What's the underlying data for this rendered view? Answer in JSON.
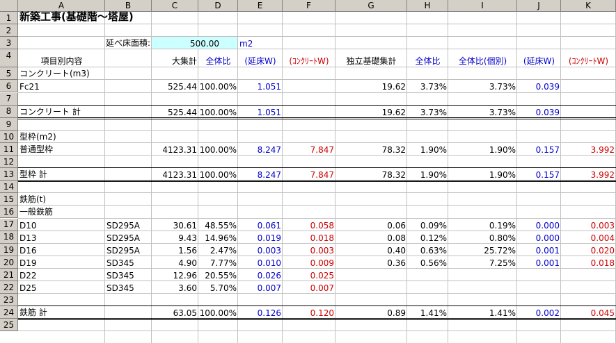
{
  "columns": [
    "A",
    "B",
    "C",
    "D",
    "E",
    "F",
    "G",
    "H",
    "I",
    "J",
    "K"
  ],
  "rows": [
    "1",
    "2",
    "3",
    "4",
    "5",
    "6",
    "7",
    "8",
    "9",
    "10",
    "11",
    "12",
    "13",
    "14",
    "15",
    "16",
    "17",
    "18",
    "19",
    "20",
    "21",
    "22",
    "23",
    "24",
    "25"
  ],
  "title": "新築工事(基礎階～塔屋)",
  "floor_area": {
    "label": "延べ床面積:",
    "value": "500.00",
    "unit": "m2",
    "fill_color": "#ccffff"
  },
  "headers": {
    "item": "項目別内容",
    "total": "大集計",
    "ratio": "全体比",
    "per_floor": "(延床W)",
    "per_concrete": "(ｺﾝｸﾘｰﾄW)",
    "footing_total": "独立基礎集計",
    "ratio2": "全体比",
    "ratio_individual": "全体比(個別)",
    "per_floor2": "(延床W)",
    "per_concrete2": "(ｺﾝｸﾘｰﾄW)"
  },
  "colors": {
    "blue": "#0000cc",
    "red": "#cc0000"
  },
  "table": [
    {
      "row": 5,
      "a": "コンクリート(m3)"
    },
    {
      "row": 6,
      "a": "Fc21",
      "c": "525.44",
      "d": "100.00%",
      "e": "1.051",
      "g": "19.62",
      "h": "3.73%",
      "i": "3.73%",
      "j": "0.039"
    },
    {
      "row": 8,
      "a": "コンクリート 計",
      "c": "525.44",
      "d": "100.00%",
      "e": "1.051",
      "g": "19.62",
      "h": "3.73%",
      "i": "3.73%",
      "j": "0.039"
    },
    {
      "row": 10,
      "a": "型枠(m2)"
    },
    {
      "row": 11,
      "a": "普通型枠",
      "c": "4123.31",
      "d": "100.00%",
      "e": "8.247",
      "f": "7.847",
      "g": "78.32",
      "h": "1.90%",
      "i": "1.90%",
      "j": "0.157",
      "k": "3.992"
    },
    {
      "row": 13,
      "a": "型枠 計",
      "c": "4123.31",
      "d": "100.00%",
      "e": "8.247",
      "f": "7.847",
      "g": "78.32",
      "h": "1.90%",
      "i": "1.90%",
      "j": "0.157",
      "k": "3.992"
    },
    {
      "row": 15,
      "a": "鉄筋(t)"
    },
    {
      "row": 16,
      "a": "一般鉄筋"
    },
    {
      "row": 17,
      "a": "D10",
      "b": "SD295A",
      "c": "30.61",
      "d": "48.55%",
      "e": "0.061",
      "f": "0.058",
      "g": "0.06",
      "h": "0.09%",
      "i": "0.19%",
      "j": "0.000",
      "k": "0.003"
    },
    {
      "row": 18,
      "a": "D13",
      "b": "SD295A",
      "c": "9.43",
      "d": "14.96%",
      "e": "0.019",
      "f": "0.018",
      "g": "0.08",
      "h": "0.12%",
      "i": "0.80%",
      "j": "0.000",
      "k": "0.004"
    },
    {
      "row": 19,
      "a": "D16",
      "b": "SD295A",
      "c": "1.56",
      "d": "2.47%",
      "e": "0.003",
      "f": "0.003",
      "g": "0.40",
      "h": "0.63%",
      "i": "25.72%",
      "j": "0.001",
      "k": "0.020"
    },
    {
      "row": 20,
      "a": "D19",
      "b": "SD345",
      "c": "4.90",
      "d": "7.77%",
      "e": "0.010",
      "f": "0.009",
      "g": "0.36",
      "h": "0.56%",
      "i": "7.25%",
      "j": "0.001",
      "k": "0.018"
    },
    {
      "row": 21,
      "a": "D22",
      "b": "SD345",
      "c": "12.96",
      "d": "20.55%",
      "e": "0.026",
      "f": "0.025"
    },
    {
      "row": 22,
      "a": "D25",
      "b": "SD345",
      "c": "3.60",
      "d": "5.70%",
      "e": "0.007",
      "f": "0.007"
    },
    {
      "row": 24,
      "a": "鉄筋 計",
      "c": "63.05",
      "d": "100.00%",
      "e": "0.126",
      "f": "0.120",
      "g": "0.89",
      "h": "1.41%",
      "i": "1.41%",
      "j": "0.002",
      "k": "0.045"
    }
  ]
}
